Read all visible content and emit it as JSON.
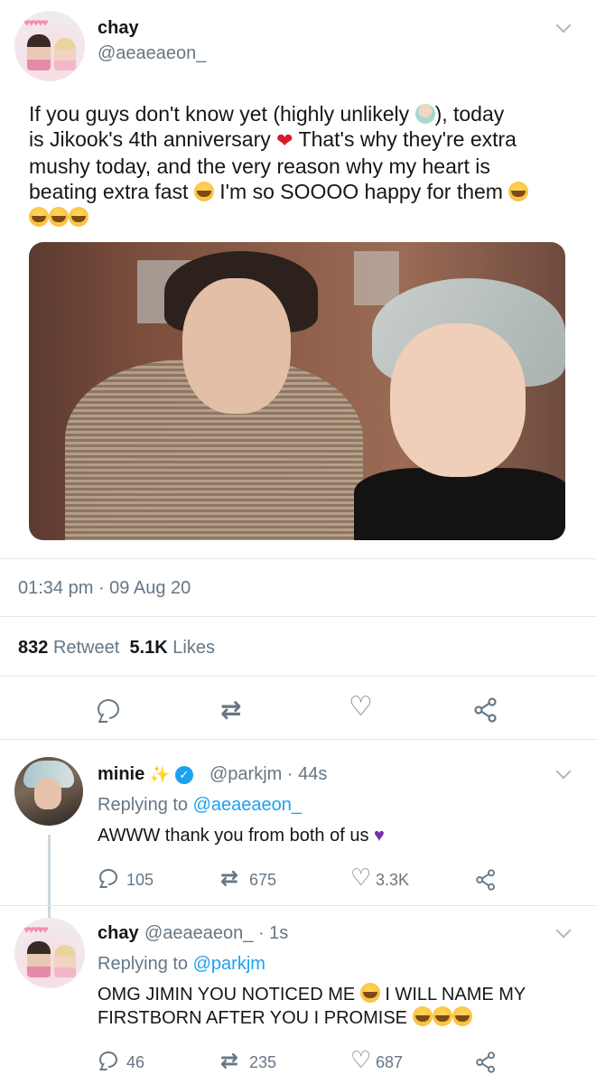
{
  "tweet": {
    "author_name": "chay",
    "author_handle": "@aeaeaeon_",
    "text_line1": "If you guys don't know yet (highly unlikely ",
    "text_line1b": "), today",
    "text_line2a": "is Jikook's 4th anniversary ",
    "text_line2b": " That's why they're extra",
    "text_line3": "mushy today, and the very reason why my heart is",
    "text_line4a": "beating extra fast ",
    "text_line4b": " I'm so SOOOO happy for them ",
    "timestamp": "01:34 pm · 09 Aug 20",
    "retweets_count": "832",
    "retweets_label": "Retweet",
    "likes_count": "5.1K",
    "likes_label": "Likes"
  },
  "replies": [
    {
      "name": "minie",
      "handle": "@parkjm · 44s",
      "replying_label": "Replying to ",
      "replying_to": "@aeaeaeon_",
      "text": "AWWW thank you from both of us ",
      "reply_count": "105",
      "retweet_count": "675",
      "like_count": "3.3K"
    },
    {
      "name": "chay",
      "handle": "@aeaeaeon_ · 1s",
      "replying_label": "Replying to ",
      "replying_to": "@parkjm",
      "text_line1": "OMG JIMIN YOU NOTICED ME ",
      "text_line1b": " I WILL NAME MY",
      "text_line2": "FIRSTBORN AFTER YOU I PROMISE ",
      "reply_count": "46",
      "retweet_count": "235",
      "like_count": "687"
    }
  ],
  "icons": {
    "reply": "reply-icon",
    "retweet": "retweet-icon",
    "like": "heart-icon",
    "share": "share-icon",
    "more": "chevron-down-icon"
  },
  "colors": {
    "link": "#1da1f2",
    "secondary_text": "#657786",
    "verified": "#1da1f2"
  }
}
